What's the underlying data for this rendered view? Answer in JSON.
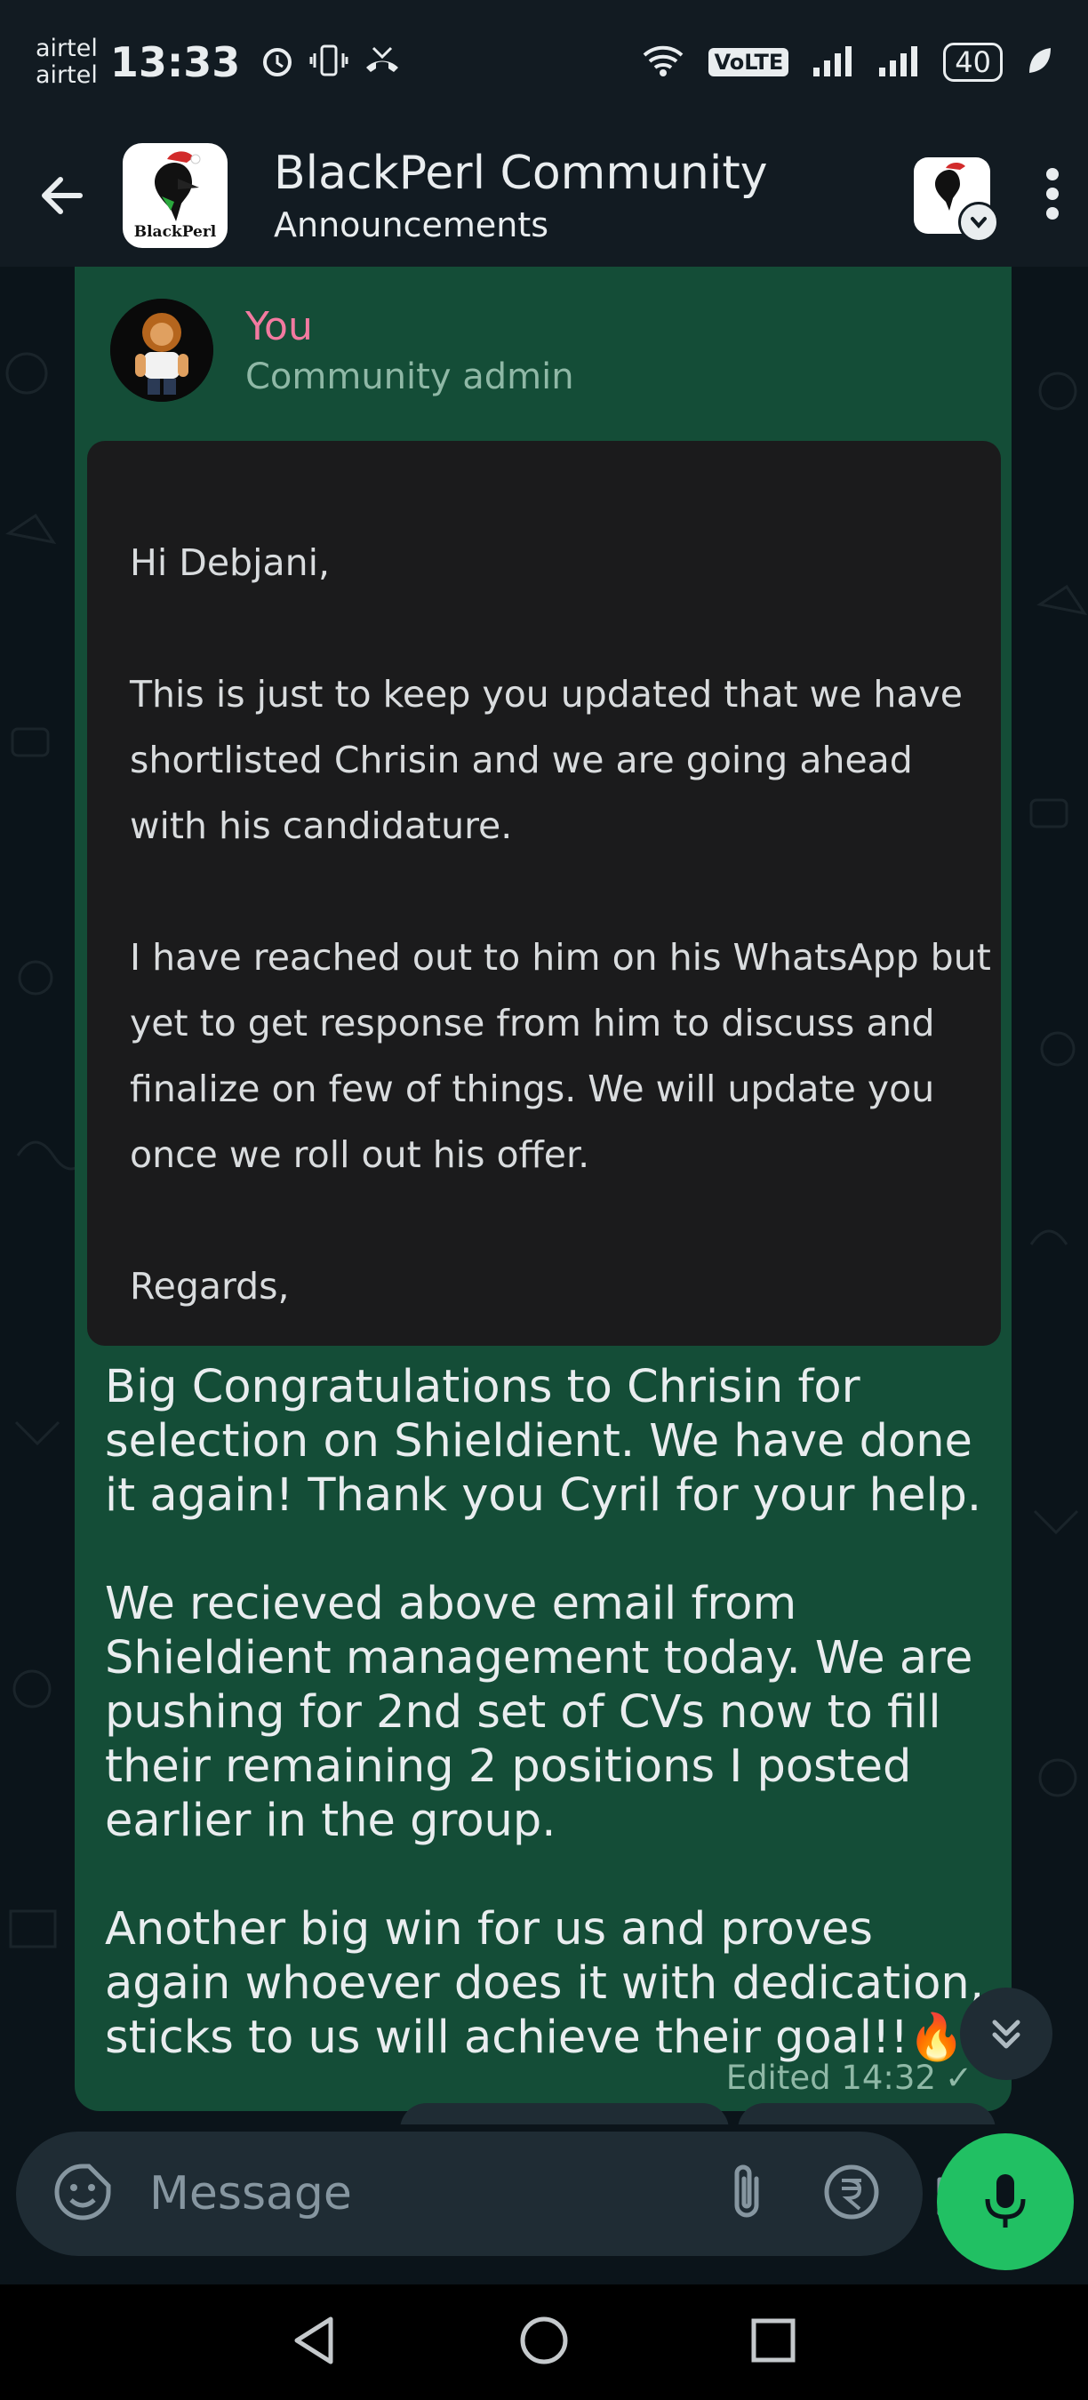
{
  "status_bar": {
    "carrier_1": "airtel",
    "carrier_2": "airtel",
    "time": "13:33",
    "volte_label": "VoLTE",
    "battery": "40"
  },
  "header": {
    "title": "BlackPerl Community",
    "subtitle": "Announcements",
    "avatar_text": "BlackPerl"
  },
  "message": {
    "sender_name": "You",
    "sender_role": "Community admin",
    "quoted_email": [
      "Hi Debjani,",
      "This is just to keep you updated that we have shortlisted Chrisin and we are going ahead with his candidature.",
      "I have reached out to him on his WhatsApp but yet to get response from him to discuss and finalize on few of things. We will update you once we roll out his offer.",
      "Regards,"
    ],
    "body": [
      "Big Congratulations to Chrisin for selection on Shieldient. We have done it again! Thank you Cyril for your help.",
      "We recieved above email from Shieldient management today. We are pushing for 2nd set of CVs now to fill their remaining 2 positions I posted earlier in the group.",
      "Another big win for us and proves again whoever does it with dedication, sticks to us will achieve their goal!!🔥"
    ],
    "footer": "Edited 14:32",
    "tick": "✓"
  },
  "composer": {
    "placeholder": "Message"
  },
  "colors": {
    "bubble": "#144d37",
    "accent": "#21c063",
    "sender_name": "#f27aa0"
  }
}
